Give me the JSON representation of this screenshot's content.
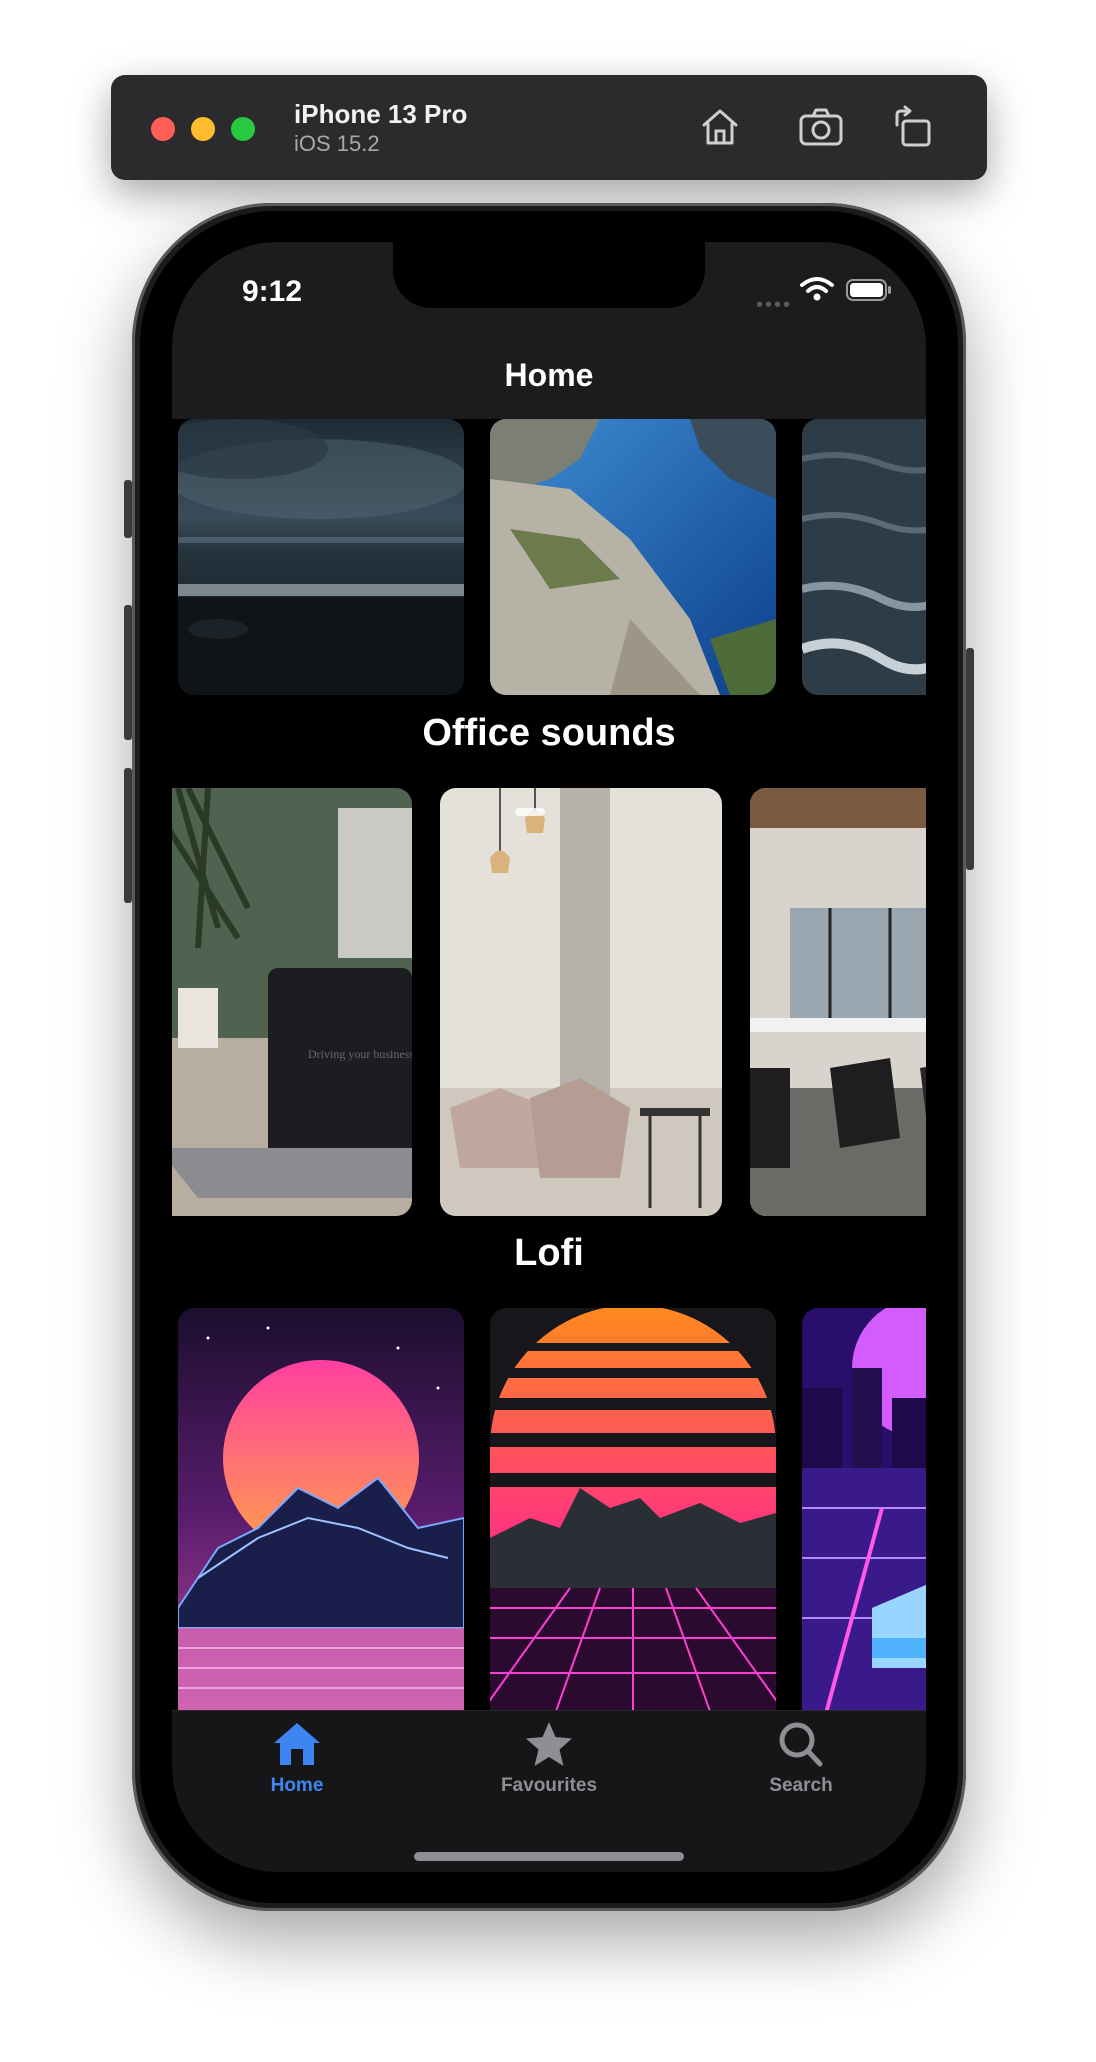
{
  "simulator": {
    "device_name": "iPhone 13 Pro",
    "os_version": "iOS 15.2",
    "toolbar_icons": [
      "home-icon",
      "screenshot-icon",
      "rotate-icon"
    ]
  },
  "status_bar": {
    "time": "9:12",
    "icons": [
      "wifi-icon",
      "battery-icon"
    ]
  },
  "nav": {
    "title": "Home"
  },
  "sections": [
    {
      "title": "",
      "cards": [
        "stormy-sea-image",
        "fjord-cliff-image",
        "ocean-waves-image"
      ]
    },
    {
      "title": "Office sounds",
      "cards": [
        "laptop-desk-image",
        "office-lounge-image",
        "open-office-image"
      ]
    },
    {
      "title": "Lofi",
      "cards": [
        "synthwave-mountain-image",
        "retro-sunset-grid-image",
        "neon-car-city-image"
      ]
    }
  ],
  "laptop_screen_text": "Driving your business",
  "tabs": [
    {
      "label": "Home",
      "icon": "house-icon",
      "active": true
    },
    {
      "label": "Favourites",
      "icon": "star-icon",
      "active": false
    },
    {
      "label": "Search",
      "icon": "magnifier-icon",
      "active": false
    }
  ],
  "colors": {
    "accent": "#3d86f2",
    "inactive_tab": "#8e8e93",
    "nav_background": "#1c1c1e",
    "tab_background": "#161618"
  }
}
